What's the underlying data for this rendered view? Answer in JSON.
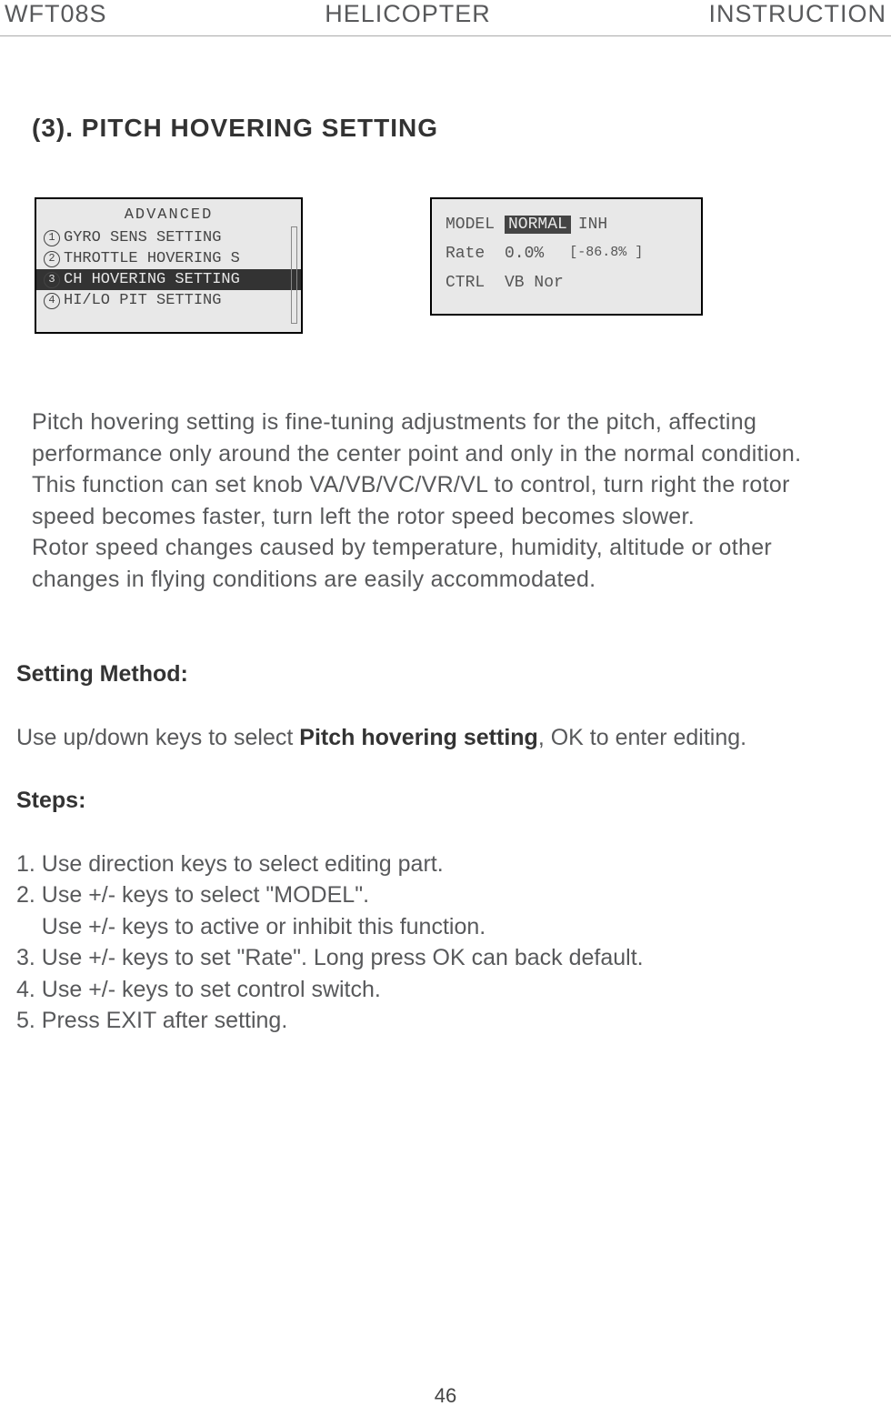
{
  "header": {
    "left": "WFT08S",
    "center": "HELICOPTER",
    "right": "INSTRUCTION"
  },
  "section_title": "(3). PITCH HOVERING SETTING",
  "screen1": {
    "title": "ADVANCED",
    "row1_num": "1",
    "row1_text": "GYRO SENS SETTING",
    "row2_num": "2",
    "row2_text": "THROTTLE HOVERING S",
    "row3_num": "3",
    "row3_text": "CH HOVERING SETTING",
    "row4_num": "4",
    "row4_text": "HI/LO PIT SETTING"
  },
  "screen2": {
    "model_label": "MODEL",
    "model_value": "NORMAL",
    "model_inh": "INH",
    "rate_label": "Rate",
    "rate_value": "0.0%",
    "rate_bracket": "[-86.8% ]",
    "ctrl_label": "CTRL",
    "ctrl_value": "VB Nor"
  },
  "description": {
    "p1": "Pitch hovering setting  is fine-tuning adjustments for the pitch, affecting performance only around the center point and only in the normal condition.",
    "p2": "This function can set knob VA/VB/VC/VR/VL  to control, turn right the rotor speed becomes faster, turn left the rotor speed becomes slower.",
    "p3": "Rotor speed changes caused by temperature, humidity, altitude or other changes in flying conditions are easily accommodated."
  },
  "setting_method": {
    "title": "Setting Method:",
    "intro_pre": "Use up/down keys to select ",
    "intro_bold": "Pitch hovering setting",
    "intro_post": ", OK to enter editing.",
    "steps_title": "Steps:",
    "step1": "1. Use direction keys to select editing part.",
    "step2a": "2. Use +/- keys to select \"MODEL\".",
    "step2b": "    Use +/- keys to active or inhibit this function.",
    "step3": "3. Use +/- keys to set \"Rate\". Long press OK can back default.",
    "step4": "4. Use +/- keys to set control switch.",
    "step5": "5. Press EXIT after setting."
  },
  "page_number": "46"
}
